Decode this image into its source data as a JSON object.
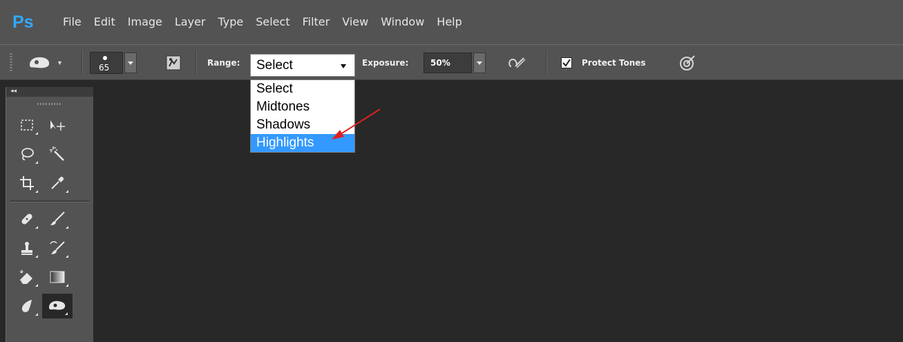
{
  "app": {
    "logo": "Ps"
  },
  "menubar": {
    "items": [
      "File",
      "Edit",
      "Image",
      "Layer",
      "Type",
      "Select",
      "Filter",
      "View",
      "Window",
      "Help"
    ]
  },
  "options": {
    "brush_size": "65",
    "range_label": "Range:",
    "range_value": "Select",
    "exposure_label": "Exposure:",
    "exposure_value": "50%",
    "protect_tones_label": "Protect Tones",
    "protect_tones_checked": true
  },
  "range_dropdown": {
    "options": [
      "Select",
      "Midtones",
      "Shadows",
      "Highlights"
    ],
    "highlighted": "Highlights"
  },
  "toolbox": {
    "collapse_label": "◂◂"
  },
  "colors": {
    "menubar": "#535353",
    "canvas": "#282828",
    "accent": "#31a8ff",
    "selection": "#3399ff",
    "annotation": "#e02020"
  }
}
